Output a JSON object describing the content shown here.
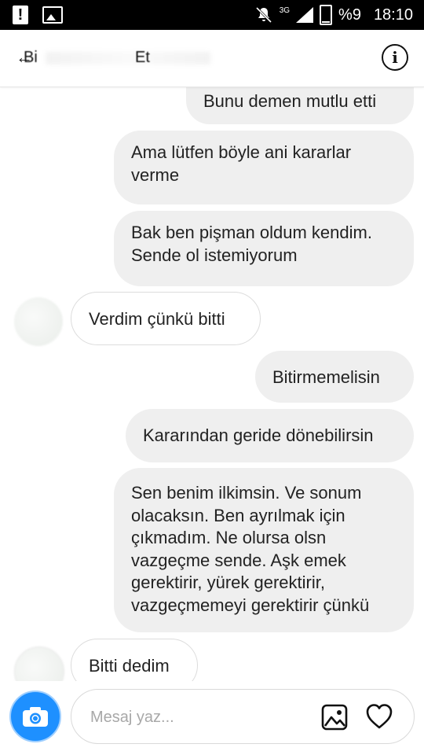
{
  "status_bar": {
    "alert": "!",
    "network": "3G",
    "battery_percent": "%9",
    "time": "18:10"
  },
  "header": {
    "back_glyph": "←",
    "name_start": "Bi",
    "name_end": "Et",
    "info_glyph": "i"
  },
  "messages": [
    {
      "direction": "out",
      "text": "Bunu demen mutlu etti"
    },
    {
      "direction": "out",
      "text": "Ama lütfen böyle ani kararlar\nverme"
    },
    {
      "direction": "out",
      "text": "Bak ben pişman oldum kendim.\nSende ol istemiyorum"
    },
    {
      "direction": "in",
      "text": "Verdim çünkü bitti"
    },
    {
      "direction": "out",
      "text": "Bitirmemelisin"
    },
    {
      "direction": "out",
      "text": "Kararından geride dönebilirsin"
    },
    {
      "direction": "out",
      "text": "Sen benim ilkimsin. Ve sonum\nolacaksın. Ben ayrılmak için\nçıkmadım. Ne olursa olsn\nvazgeçme sende. Aşk emek\ngerektirir, yürek gerektirir,\nvazgeçmemeyi gerektirir çünkü"
    },
    {
      "direction": "in",
      "text": "Bitti dedim"
    }
  ],
  "composer": {
    "placeholder": "Mesaj yaz...",
    "value": ""
  },
  "colors": {
    "accent": "#1e90ff",
    "outgoing_bubble": "#efefef",
    "incoming_border": "#dcdcdc"
  },
  "icons": [
    "alert-icon",
    "image-icon",
    "mute-icon",
    "signal-icon",
    "battery-icon",
    "back-icon",
    "info-icon",
    "camera-icon",
    "gallery-icon",
    "heart-icon"
  ]
}
